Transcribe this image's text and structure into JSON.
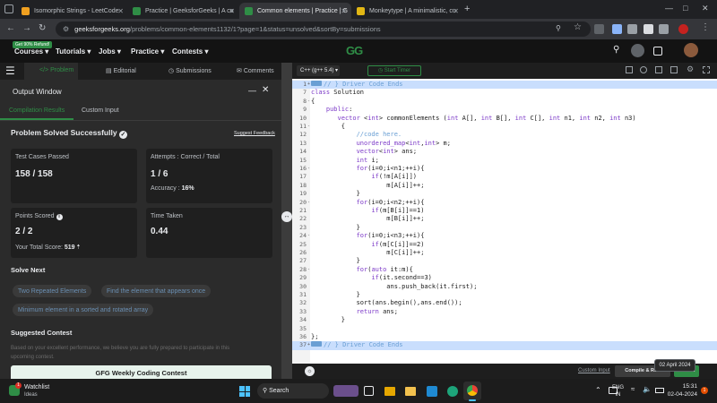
{
  "browser": {
    "tabs": [
      {
        "title": "Isomorphic Strings - LeetCode",
        "color": "#f0a020"
      },
      {
        "title": "Practice | GeeksforGeeks | A co",
        "color": "#2f8d46"
      },
      {
        "title": "Common elements | Practice | G",
        "color": "#2f8d46"
      },
      {
        "title": "Monkeytype | A minimalistic, cu",
        "color": "#e2b714"
      }
    ],
    "new_tab": "+",
    "url_host": "geeksforgeeks.org",
    "url_path": "/problems/common-elements1132/1?page=1&status=unsolved&sortBy=submissions"
  },
  "gfg": {
    "badge": "Get 90% Refund!",
    "nav": [
      "Courses",
      "Tutorials",
      "Jobs",
      "Practice",
      "Contests"
    ],
    "logo": "GG"
  },
  "problem_tabs": [
    "Problem",
    "Editorial",
    "Submissions",
    "Comments"
  ],
  "output": {
    "window_title": "Output Window",
    "tab_results": "Compilation Results",
    "tab_custom": "Custom Input",
    "status": "Problem Solved Successfully",
    "feedback": "Suggest Feedback",
    "test_cases_label": "Test Cases Passed",
    "test_cases_value": "158 / 158",
    "attempts_label": "Attempts : Correct / Total",
    "attempts_value": "1 / 6",
    "accuracy_label": "Accuracy :",
    "accuracy_value": "16%",
    "points_label": "Points Scored",
    "points_value": "2 / 2",
    "total_score_label": "Your Total Score:",
    "total_score_value": "519",
    "time_label": "Time Taken",
    "time_value": "0.44",
    "solve_next": "Solve Next",
    "chips": [
      "Two Repeated Elements",
      "Find the element that appears once",
      "Minimum element in a sorted and rotated array"
    ],
    "suggested_contest": "Suggested Contest",
    "contest_text_1": "Based on your excellent performance, we believe you are fully prepared to participate in this",
    "contest_text_2": "upcoming contest.",
    "contest_banner": "GFG Weekly Coding Contest"
  },
  "editor": {
    "language": "C++ (g++ 5.4)",
    "start_timer": "Start Timer",
    "custom_input": "Custom Input",
    "compile_run": "Compile & Run",
    "submit": "Submit",
    "tooltip": "02 April 2024",
    "lines": [
      {
        "n": "1",
        "fold": "+",
        "code": "// } Driver Code Ends",
        "hl": true
      },
      {
        "n": "7",
        "fold": "",
        "code": "class Solution",
        "hl": false
      },
      {
        "n": "8",
        "fold": "-",
        "code": "{",
        "hl": false
      },
      {
        "n": "9",
        "fold": "",
        "code": "    public:",
        "hl": false
      },
      {
        "n": "10",
        "fold": "",
        "code": "       vector <int> commonElements (int A[], int B[], int C[], int n1, int n2, int n3)",
        "hl": false
      },
      {
        "n": "11",
        "fold": "-",
        "code": "        {",
        "hl": false
      },
      {
        "n": "12",
        "fold": "",
        "code": "            //code here.",
        "hl": false
      },
      {
        "n": "13",
        "fold": "",
        "code": "            unordered_map<int,int> m;",
        "hl": false
      },
      {
        "n": "14",
        "fold": "",
        "code": "            vector<int> ans;",
        "hl": false
      },
      {
        "n": "15",
        "fold": "",
        "code": "            int i;",
        "hl": false
      },
      {
        "n": "16",
        "fold": "-",
        "code": "            for(i=0;i<n1;++i){",
        "hl": false
      },
      {
        "n": "17",
        "fold": "",
        "code": "                if(!m[A[i]])",
        "hl": false
      },
      {
        "n": "18",
        "fold": "",
        "code": "                    m[A[i]]++;",
        "hl": false
      },
      {
        "n": "19",
        "fold": "",
        "code": "            }",
        "hl": false
      },
      {
        "n": "20",
        "fold": "-",
        "code": "            for(i=0;i<n2;++i){",
        "hl": false
      },
      {
        "n": "21",
        "fold": "",
        "code": "                if(m[B[i]]==1)",
        "hl": false
      },
      {
        "n": "22",
        "fold": "",
        "code": "                    m[B[i]]++;",
        "hl": false
      },
      {
        "n": "23",
        "fold": "",
        "code": "            }",
        "hl": false
      },
      {
        "n": "24",
        "fold": "-",
        "code": "            for(i=0;i<n3;++i){",
        "hl": false
      },
      {
        "n": "25",
        "fold": "",
        "code": "                if(m[C[i]]==2)",
        "hl": false
      },
      {
        "n": "26",
        "fold": "",
        "code": "                    m[C[i]]++;",
        "hl": false
      },
      {
        "n": "27",
        "fold": "",
        "code": "            }",
        "hl": false
      },
      {
        "n": "28",
        "fold": "-",
        "code": "            for(auto it:m){",
        "hl": false
      },
      {
        "n": "29",
        "fold": "",
        "code": "                if(it.second==3)",
        "hl": false
      },
      {
        "n": "30",
        "fold": "",
        "code": "                    ans.push_back(it.first);",
        "hl": false
      },
      {
        "n": "31",
        "fold": "",
        "code": "            }",
        "hl": false
      },
      {
        "n": "32",
        "fold": "",
        "code": "            sort(ans.begin(),ans.end());",
        "hl": false
      },
      {
        "n": "33",
        "fold": "",
        "code": "            return ans;",
        "hl": false
      },
      {
        "n": "34",
        "fold": "",
        "code": "        }",
        "hl": false
      },
      {
        "n": "35",
        "fold": "",
        "code": "",
        "hl": false
      },
      {
        "n": "36",
        "fold": "",
        "code": "};",
        "hl": false
      },
      {
        "n": "37",
        "fold": "+",
        "code": "// } Driver Code Ends",
        "hl": true
      }
    ]
  },
  "taskbar": {
    "weather_title": "Watchlist",
    "weather_sub": "Ideas",
    "notif_count": "1",
    "search": "Search",
    "lang1": "ENG",
    "lang2": "IN",
    "time": "15:31",
    "date": "02-04-2024"
  }
}
